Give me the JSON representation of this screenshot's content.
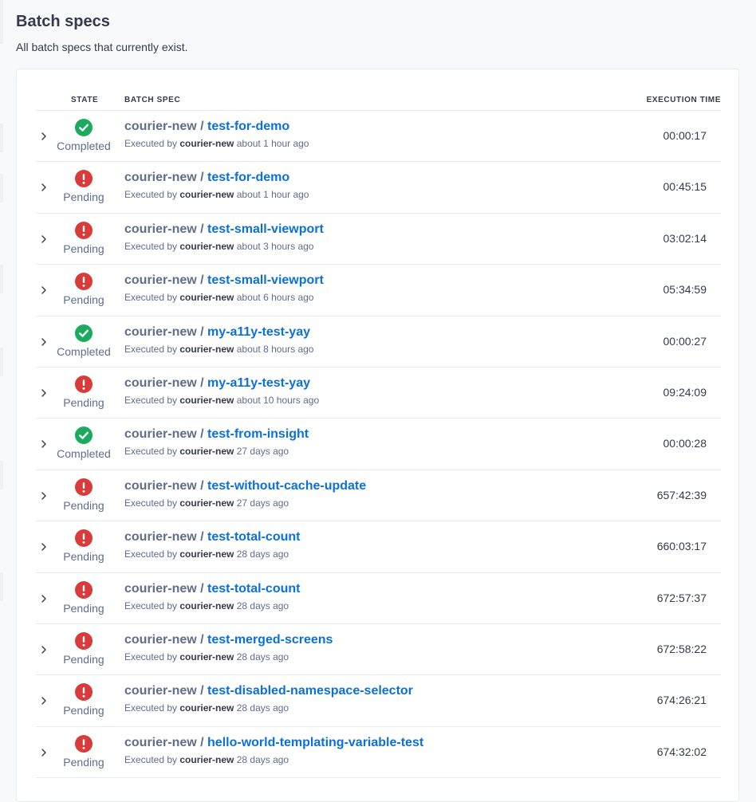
{
  "page": {
    "title": "Batch specs",
    "subtitle": "All batch specs that currently exist."
  },
  "table": {
    "headers": {
      "state": "STATE",
      "spec": "BATCH SPEC",
      "time": "EXECUTION TIME"
    },
    "rows": [
      {
        "state": "Completed",
        "namespace": "courier-new",
        "separator": " / ",
        "name": "test-for-demo",
        "executed_prefix": "Executed by ",
        "user": "courier-new",
        "when": " about 1 hour ago",
        "time": "00:00:17"
      },
      {
        "state": "Pending",
        "namespace": "courier-new",
        "separator": " / ",
        "name": "test-for-demo",
        "executed_prefix": "Executed by ",
        "user": "courier-new",
        "when": " about 1 hour ago",
        "time": "00:45:15"
      },
      {
        "state": "Pending",
        "namespace": "courier-new",
        "separator": " / ",
        "name": "test-small-viewport",
        "executed_prefix": "Executed by ",
        "user": "courier-new",
        "when": " about 3 hours ago",
        "time": "03:02:14"
      },
      {
        "state": "Pending",
        "namespace": "courier-new",
        "separator": " / ",
        "name": "test-small-viewport",
        "executed_prefix": "Executed by ",
        "user": "courier-new",
        "when": " about 6 hours ago",
        "time": "05:34:59"
      },
      {
        "state": "Completed",
        "namespace": "courier-new",
        "separator": " / ",
        "name": "my-a11y-test-yay",
        "executed_prefix": "Executed by ",
        "user": "courier-new",
        "when": " about 8 hours ago",
        "time": "00:00:27"
      },
      {
        "state": "Pending",
        "namespace": "courier-new",
        "separator": " / ",
        "name": "my-a11y-test-yay",
        "executed_prefix": "Executed by ",
        "user": "courier-new",
        "when": " about 10 hours ago",
        "time": "09:24:09"
      },
      {
        "state": "Completed",
        "namespace": "courier-new",
        "separator": " / ",
        "name": "test-from-insight",
        "executed_prefix": "Executed by ",
        "user": "courier-new",
        "when": " 27 days ago",
        "time": "00:00:28"
      },
      {
        "state": "Pending",
        "namespace": "courier-new",
        "separator": " / ",
        "name": "test-without-cache-update",
        "executed_prefix": "Executed by ",
        "user": "courier-new",
        "when": " 27 days ago",
        "time": "657:42:39"
      },
      {
        "state": "Pending",
        "namespace": "courier-new",
        "separator": " / ",
        "name": "test-total-count",
        "executed_prefix": "Executed by ",
        "user": "courier-new",
        "when": " 28 days ago",
        "time": "660:03:17"
      },
      {
        "state": "Pending",
        "namespace": "courier-new",
        "separator": " / ",
        "name": "test-total-count",
        "executed_prefix": "Executed by ",
        "user": "courier-new",
        "when": " 28 days ago",
        "time": "672:57:37"
      },
      {
        "state": "Pending",
        "namespace": "courier-new",
        "separator": " / ",
        "name": "test-merged-screens",
        "executed_prefix": "Executed by ",
        "user": "courier-new",
        "when": " 28 days ago",
        "time": "672:58:22"
      },
      {
        "state": "Pending",
        "namespace": "courier-new",
        "separator": " / ",
        "name": "test-disabled-namespace-selector",
        "executed_prefix": "Executed by ",
        "user": "courier-new",
        "when": " 28 days ago",
        "time": "674:26:21"
      },
      {
        "state": "Pending",
        "namespace": "courier-new",
        "separator": " / ",
        "name": "hello-world-templating-variable-test",
        "executed_prefix": "Executed by ",
        "user": "courier-new",
        "when": " 28 days ago",
        "time": "674:32:02"
      }
    ]
  },
  "colors": {
    "completed": "#1aab5e",
    "pending": "#d93a3a",
    "link": "#0b70db",
    "muted": "#5e6e8c"
  },
  "icons": {
    "completed": "check-circle-icon",
    "pending": "exclamation-circle-icon",
    "expand": "chevron-right-icon"
  }
}
